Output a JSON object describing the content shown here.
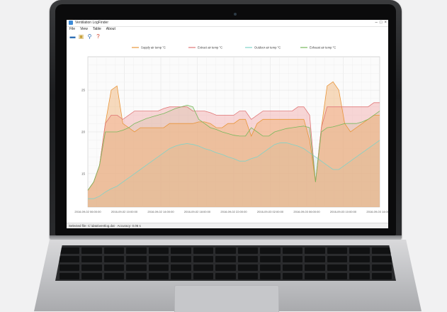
{
  "window": {
    "title": "Ventilation LogFinder"
  },
  "menu": [
    {
      "label": "File"
    },
    {
      "label": "View"
    },
    {
      "label": "Table"
    },
    {
      "label": "About"
    }
  ],
  "toolbar": [
    {
      "icon": "folder-open-icon",
      "glyph": "▬",
      "color": "#2f6fb5"
    },
    {
      "icon": "save-icon",
      "glyph": "▣",
      "color": "#c8a23c"
    },
    {
      "icon": "zoom-icon",
      "glyph": "⚲",
      "color": "#2f6fb5"
    },
    {
      "icon": "help-icon",
      "glyph": "?",
      "color": "#d0402a"
    }
  ],
  "status": {
    "text": "Selected file: C:\\data\\ventlog.dat · Accuracy: 0.06 s"
  },
  "chart_data": {
    "type": "area",
    "legend_position": "top",
    "ylim": [
      11,
      29
    ],
    "y_ticks": [
      "15",
      "20",
      "25"
    ],
    "x_ticks": [
      "2016-09-02 06:00:00",
      "2016-09-02 10:00:00",
      "2016-09-02 14:00:00",
      "2016-09-02 18:00:00",
      "2016-09-02 22:00:00",
      "2016-09-03 02:00:00",
      "2016-09-03 06:00:00",
      "2016-09-03 10:00:00",
      "2016-09-03 14:00:00"
    ],
    "grid": true,
    "x": [
      0,
      2,
      4,
      6,
      8,
      10,
      12,
      14,
      16,
      18,
      20,
      22,
      24,
      26,
      28,
      30,
      32,
      34,
      36,
      38,
      40,
      42,
      44,
      46,
      48,
      50,
      52,
      54,
      56,
      58,
      60,
      62,
      64,
      66,
      68,
      70,
      72,
      74,
      76,
      78,
      80,
      82,
      84,
      86,
      88,
      90,
      92,
      94,
      96,
      98,
      100
    ],
    "series": [
      {
        "name": "Supply air temp °C",
        "color": "#e8953a",
        "fill": "rgba(240,175,110,0.45)",
        "values": [
          13,
          14,
          16,
          21,
          25,
          25.5,
          21,
          20.5,
          20,
          20.5,
          20.5,
          20.5,
          20.5,
          20.5,
          21,
          21,
          21,
          21,
          21,
          21.2,
          21.2,
          21,
          20.5,
          20.5,
          21,
          21,
          21.5,
          21.5,
          19.5,
          21,
          21.5,
          21.5,
          21.5,
          21.5,
          21.5,
          21.5,
          21.5,
          21.5,
          19,
          14,
          20.5,
          25.5,
          26,
          25,
          21,
          20,
          20.5,
          21,
          21.5,
          22,
          22
        ]
      },
      {
        "name": "Extract air temp °C",
        "color": "#e07777",
        "fill": "rgba(240,160,160,0.42)",
        "values": [
          13,
          14,
          16,
          21,
          22,
          22,
          21.5,
          22,
          22.5,
          22.5,
          22.5,
          22.5,
          22.5,
          22.8,
          23,
          23,
          23,
          23,
          22.5,
          22.5,
          22.5,
          22.3,
          22,
          22,
          22,
          22,
          22.5,
          22.5,
          21.5,
          22,
          22.5,
          22.5,
          22.5,
          22.5,
          22.5,
          22.5,
          23,
          23,
          22,
          14,
          20.5,
          23,
          23,
          23,
          23,
          23,
          23,
          23,
          23,
          23.5,
          23.5
        ]
      },
      {
        "name": "Outdoor air temp °C",
        "color": "#7fd3c8",
        "fill": "rgba(160,220,210,0.25)",
        "values": [
          12,
          12,
          12.3,
          12.8,
          13.2,
          13.5,
          14,
          14.5,
          15,
          15.5,
          16,
          16.5,
          17,
          17.5,
          18,
          18.3,
          18.5,
          18.6,
          18.5,
          18.3,
          18,
          17.8,
          17.5,
          17.3,
          17,
          16.8,
          16.5,
          16.5,
          16.8,
          17,
          17.5,
          18,
          18.5,
          18.7,
          18.7,
          18.5,
          18.3,
          18,
          17.5,
          17,
          16.5,
          16,
          15.5,
          15.5,
          16,
          16.5,
          17,
          17.5,
          18,
          18.5,
          19
        ]
      },
      {
        "name": "Exhaust air temp °C",
        "color": "#78b85c",
        "fill": "rgba(170,200,140,0.25)",
        "values": [
          13,
          14,
          16,
          20,
          20,
          20,
          20.2,
          20.5,
          21,
          21.3,
          21.6,
          21.8,
          22,
          22.2,
          22.5,
          22.8,
          23,
          23.2,
          23,
          21.5,
          21,
          20.5,
          20.3,
          20,
          19.8,
          19.6,
          19.5,
          19.5,
          20.5,
          20,
          19.5,
          19.5,
          20,
          20.2,
          20.4,
          20.5,
          20.6,
          20.7,
          20.5,
          14,
          20,
          20.5,
          20.6,
          20.8,
          21,
          21,
          21,
          21.2,
          21.5,
          22,
          22.5
        ]
      }
    ]
  }
}
